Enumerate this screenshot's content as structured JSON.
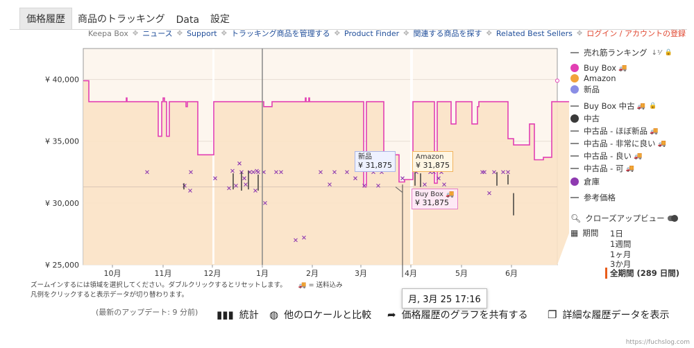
{
  "tabs": [
    "価格履歴",
    "商品のトラッキング",
    "Data",
    "設定"
  ],
  "subnav": [
    {
      "label": "Keepa Box",
      "style": "gray"
    },
    {
      "label": "ニュース",
      "style": "link"
    },
    {
      "label": "Support",
      "style": "link"
    },
    {
      "label": "トラッキング商品を管理する",
      "style": "link"
    },
    {
      "label": "Product Finder",
      "style": "link"
    },
    {
      "label": "関連する商品を探す",
      "style": "link"
    },
    {
      "label": "Related Best Sellers",
      "style": "link"
    },
    {
      "label": "ログイン / アカウントの登録",
      "style": "red"
    }
  ],
  "chart_data": {
    "type": "line",
    "y_tick_labels": [
      "¥ 40,000",
      "¥ 35,000",
      "¥ 30,000",
      "¥ 25,000"
    ],
    "y_ticks": [
      40000,
      35000,
      30000,
      25000
    ],
    "ylim": [
      25000,
      42500
    ],
    "x_tick_labels": [
      "10月",
      "11月",
      "12月",
      "1月",
      "2月",
      "3月",
      "4月",
      "5月",
      "6月"
    ],
    "series": [
      {
        "name": "Buy Box",
        "color": "#e23fb3",
        "points": [
          [
            0,
            39900
          ],
          [
            8,
            39900
          ],
          [
            8,
            38200
          ],
          [
            62,
            38200
          ],
          [
            62,
            38500
          ],
          [
            63,
            38500
          ],
          [
            63,
            38200
          ],
          [
            108,
            38200
          ],
          [
            108,
            35400
          ],
          [
            113,
            35400
          ],
          [
            113,
            38200
          ],
          [
            115,
            38200
          ],
          [
            115,
            38500
          ],
          [
            117,
            38500
          ],
          [
            117,
            38200
          ],
          [
            120,
            38200
          ],
          [
            120,
            35400
          ],
          [
            124,
            35400
          ],
          [
            124,
            38200
          ],
          [
            148,
            38200
          ],
          [
            148,
            37800
          ],
          [
            150,
            37800
          ],
          [
            150,
            38200
          ],
          [
            165,
            38200
          ],
          [
            165,
            33900
          ],
          [
            188,
            33900
          ],
          [
            188,
            38200
          ],
          [
            260,
            38200
          ],
          [
            260,
            37800
          ],
          [
            272,
            37800
          ],
          [
            272,
            38200
          ],
          [
            320,
            38200
          ],
          [
            320,
            38500
          ],
          [
            321,
            38500
          ],
          [
            321,
            38200
          ],
          [
            325,
            38200
          ],
          [
            325,
            38500
          ],
          [
            326,
            38500
          ],
          [
            326,
            38200
          ],
          [
            404,
            38200
          ],
          [
            404,
            31300
          ],
          [
            408,
            31300
          ],
          [
            408,
            38200
          ],
          [
            433,
            38200
          ],
          [
            433,
            33900
          ],
          [
            455,
            33900
          ],
          [
            455,
            31700
          ],
          [
            463,
            31700
          ],
          [
            463,
            31900
          ],
          [
            475,
            31900
          ],
          [
            475,
            38200
          ],
          [
            506,
            38200
          ],
          [
            506,
            31600
          ],
          [
            510,
            31600
          ],
          [
            510,
            38200
          ],
          [
            530,
            38200
          ],
          [
            530,
            36400
          ],
          [
            537,
            36400
          ],
          [
            537,
            38200
          ],
          [
            560,
            38200
          ],
          [
            560,
            36400
          ],
          [
            568,
            36400
          ],
          [
            568,
            37800
          ],
          [
            570,
            37800
          ],
          [
            570,
            38200
          ],
          [
            612,
            38200
          ],
          [
            612,
            35200
          ],
          [
            620,
            35200
          ],
          [
            620,
            34700
          ],
          [
            643,
            34700
          ],
          [
            643,
            36400
          ],
          [
            650,
            36400
          ],
          [
            650,
            33500
          ],
          [
            663,
            33500
          ],
          [
            663,
            33700
          ],
          [
            675,
            33700
          ],
          [
            675,
            38200
          ],
          [
            708,
            38200
          ],
          [
            708,
            35200
          ],
          [
            718,
            35200
          ],
          [
            718,
            38200
          ],
          [
            725,
            38200
          ],
          [
            725,
            33300
          ],
          [
            735,
            33300
          ],
          [
            735,
            38200
          ],
          [
            782,
            38200
          ],
          [
            782,
            39900
          ]
        ]
      },
      {
        "name": "Amazon",
        "color": "#f7a133"
      },
      {
        "name": "新品",
        "color": "#8a8ee5"
      },
      {
        "name": "中古",
        "color": "#333333"
      },
      {
        "name": "倉庫",
        "color": "#8e3ab0"
      }
    ],
    "used_points_yen": [
      32500,
      31400,
      31000,
      32500,
      32000,
      31200,
      32600,
      31400,
      33200,
      32500,
      32000,
      31500,
      32500,
      32500,
      31000,
      32600,
      32500,
      32500,
      30000,
      32500,
      32500,
      27000,
      27200,
      32500,
      31500,
      32500,
      32500,
      32000,
      31400,
      32500,
      31400,
      32500,
      32000,
      32500,
      31500,
      32500,
      32500,
      32000,
      32500,
      31500,
      32500,
      32500,
      30800,
      32500,
      32500,
      32500
    ]
  },
  "tooltips": {
    "new": {
      "label": "新品",
      "value": "¥ 31,875"
    },
    "amazon": {
      "label": "Amazon",
      "value": "¥ 31,875"
    },
    "buybox": {
      "label": "Buy Box 🚚",
      "value": "¥ 31,875"
    },
    "date": "月, 3月 25 17:16"
  },
  "hints": {
    "line1": "ズームインするには領域を選択してください。ダブルクリックするとリセットします。",
    "shipping": "🚚 = 送料込み",
    "line2": "凡例をクリックすると表示データが切り替わります。"
  },
  "legend": {
    "sales_rank": "売れ筋ランキング",
    "items": [
      {
        "label": "Buy Box",
        "color": "#e23fb3",
        "truck": true
      },
      {
        "label": "Amazon",
        "color": "#f2a23a"
      },
      {
        "label": "新品",
        "color": "#8a8ee5"
      },
      {
        "label": "Buy Box 中古",
        "dash": true,
        "truck": true,
        "lock": true
      },
      {
        "label": "中古",
        "color": "#3a3a3a"
      },
      {
        "label": "中古品 - ほぼ新品",
        "dash": true,
        "truck": true
      },
      {
        "label": "中古品 - 非常に良い",
        "dash": true,
        "truck": true
      },
      {
        "label": "中古品 - 良い",
        "dash": true,
        "truck": true
      },
      {
        "label": "中古品 - 可",
        "dash": true,
        "truck": true
      },
      {
        "label": "倉庫",
        "color": "#8e3ab0"
      },
      {
        "label": "参考価格",
        "dash": true
      }
    ],
    "close_up": "クローズアップビュー",
    "period_label": "期間",
    "periods": [
      "1日",
      "1週間",
      "1ヶ月",
      "3か月",
      "全期間 (289 日間)"
    ],
    "period_selected": 4
  },
  "bottom": {
    "updated": "(最新のアップデート: 9 分前)",
    "stats": "統計",
    "compare": "他のロケールと比較",
    "share": "価格履歴のグラフを共有する",
    "details": "詳細な履歴データを表示"
  },
  "credit": "https://fuchslog.com"
}
